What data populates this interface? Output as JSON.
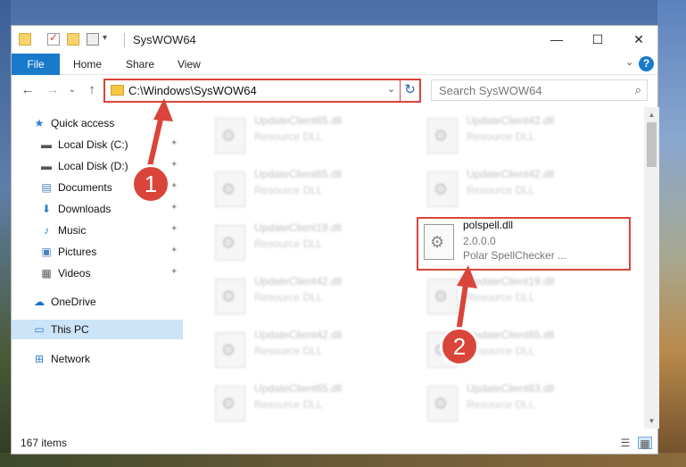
{
  "window": {
    "title": "SysWOW64",
    "controls": {
      "minimize": "—",
      "maximize": "☐",
      "close": "✕"
    }
  },
  "ribbon": {
    "tabs": [
      "File",
      "Home",
      "Share",
      "View"
    ],
    "expand_glyph": "⌄",
    "help_glyph": "?"
  },
  "nav": {
    "back_glyph": "←",
    "forward_glyph": "→",
    "recent_glyph": "⌄",
    "up_glyph": "↑",
    "address": "C:\\Windows\\SysWOW64",
    "dropdown_glyph": "⌄",
    "refresh_glyph": "↻",
    "search_placeholder": "Search SysWOW64",
    "search_glyph": "⌕"
  },
  "sidebar": {
    "items": [
      {
        "label": "Quick access",
        "icon": "star-icon",
        "glyph": "★",
        "color": "#2f7fd0",
        "pinned": false
      },
      {
        "label": "Local Disk (C:)",
        "icon": "drive-icon",
        "glyph": "▬",
        "color": "#555555",
        "pinned": true
      },
      {
        "label": "Local Disk (D:)",
        "icon": "drive-icon",
        "glyph": "▬",
        "color": "#555555",
        "pinned": true
      },
      {
        "label": "Documents",
        "icon": "documents-icon",
        "glyph": "▤",
        "color": "#4a7fc0",
        "pinned": true
      },
      {
        "label": "Downloads",
        "icon": "download-icon",
        "glyph": "⬇",
        "color": "#2f7fd0",
        "pinned": true
      },
      {
        "label": "Music",
        "icon": "music-icon",
        "glyph": "♪",
        "color": "#2f7fd0",
        "pinned": true
      },
      {
        "label": "Pictures",
        "icon": "pictures-icon",
        "glyph": "▣",
        "color": "#4a7fc0",
        "pinned": true
      },
      {
        "label": "Videos",
        "icon": "video-icon",
        "glyph": "▦",
        "color": "#555555",
        "pinned": true
      },
      {
        "label": "OneDrive",
        "icon": "cloud-icon",
        "glyph": "☁",
        "color": "#1a6fc4",
        "pinned": false
      },
      {
        "label": "This PC",
        "icon": "computer-icon",
        "glyph": "▭",
        "color": "#2f7fd0",
        "pinned": false
      },
      {
        "label": "Network",
        "icon": "network-icon",
        "glyph": "⊞",
        "color": "#2f7fd0",
        "pinned": false
      }
    ],
    "pin_glyph": "📌"
  },
  "files": {
    "left": [
      {
        "name": "UpdateClient65.dll",
        "type": "Resource DLL"
      },
      {
        "name": "UpdateClient65.dll",
        "type": "Resource DLL"
      },
      {
        "name": "UpdateClient19.dll",
        "type": "Resource DLL"
      },
      {
        "name": "UpdateClient42.dll",
        "type": "Resource DLL"
      },
      {
        "name": "UpdateClient42.dll",
        "type": "Resource DLL"
      },
      {
        "name": "UpdateClient65.dll",
        "type": "Resource DLL"
      }
    ],
    "right": [
      {
        "name": "UpdateClient42.dll",
        "type": "Resource DLL"
      },
      {
        "name": "UpdateClient42.dll",
        "type": "Resource DLL"
      },
      {
        "name": "UpdateClient19.dll",
        "type": "Resource DLL"
      },
      {
        "name": "UpdateClient65.dll",
        "type": "Resource DLL"
      },
      {
        "name": "UpdateClient63.dll",
        "type": "Resource DLL"
      }
    ],
    "highlighted": {
      "name": "polspell.dll",
      "version": "2.0.0.0",
      "description": "Polar SpellChecker ..."
    }
  },
  "status": {
    "item_count": "167 items"
  },
  "callouts": [
    "1",
    "2"
  ],
  "colors": {
    "accent": "#1979ca",
    "highlight_red": "#d9453a",
    "selected_bg": "#cce4f7"
  }
}
